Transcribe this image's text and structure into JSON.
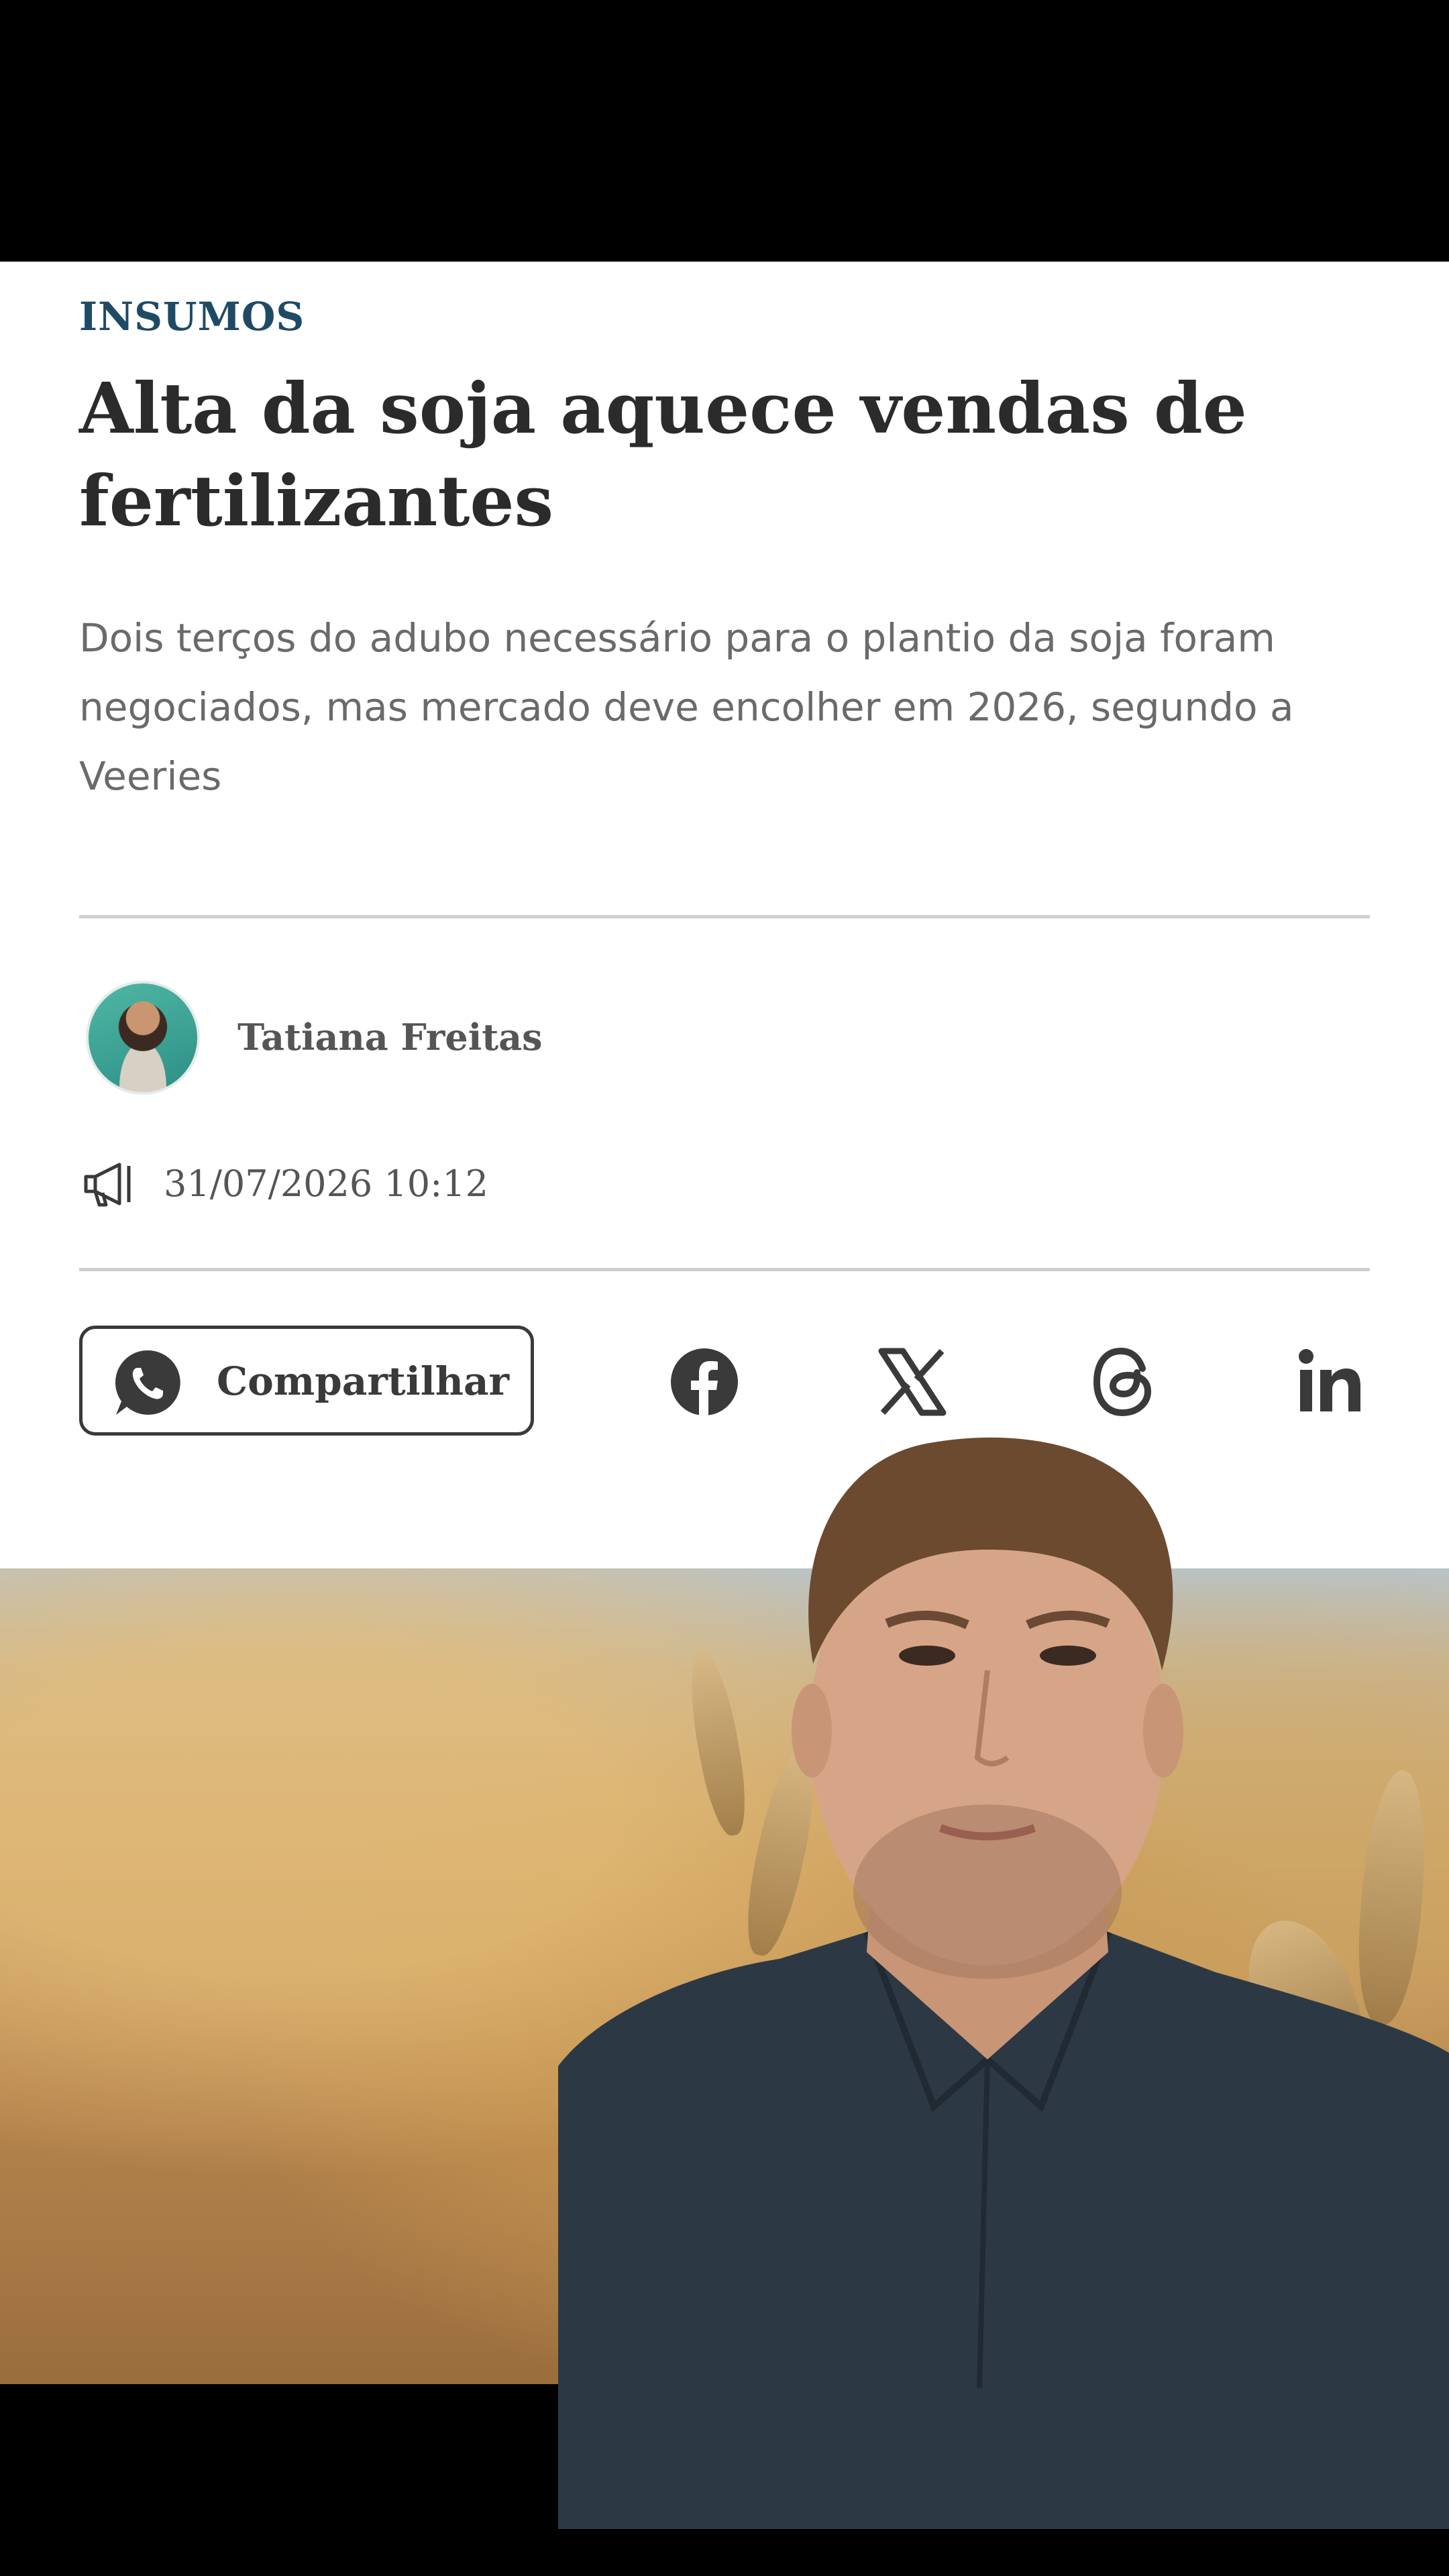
{
  "article": {
    "category": "INSUMOS",
    "headline_line1": "Alta da soja aquece vendas de",
    "headline_line2": "fertilizantes",
    "subtitle_line1": "Dois terços do adubo necessário para o plantio da soja foram",
    "subtitle_line2": "negociados, mas mercado deve encolher em 2026, segundo a",
    "subtitle_line3": "Veeries",
    "author": "Tatiana Freitas",
    "datetime": "31/07/2026 10:12"
  },
  "share": {
    "label": "Compartilhar",
    "icons": [
      "whatsapp-icon",
      "facebook-icon",
      "x-icon",
      "threads-icon",
      "linkedin-icon"
    ]
  },
  "colors": {
    "category": "#1f4a66",
    "headline": "#2b2b2b",
    "subtitle": "#6a6a6a",
    "divider": "#cfcfcf"
  }
}
